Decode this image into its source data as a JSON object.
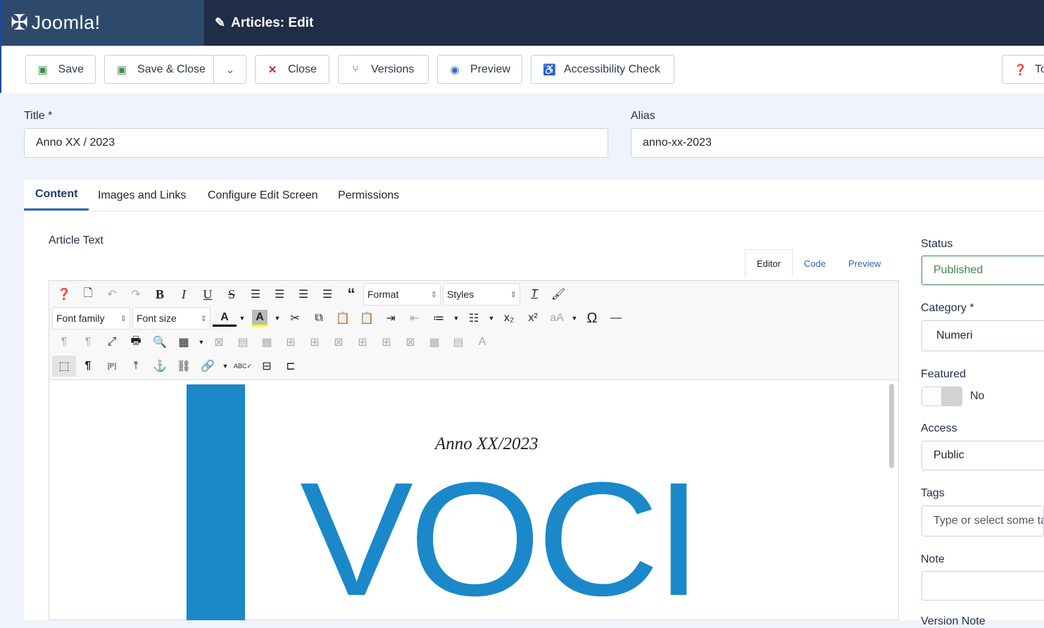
{
  "header": {
    "logo": "Joomla!",
    "title": "Articles: Edit"
  },
  "toolbar": {
    "save": "Save",
    "save_close": "Save & Close",
    "close": "Close",
    "versions": "Versions",
    "preview": "Preview",
    "accessibility": "Accessibility Check",
    "tour": "To"
  },
  "form": {
    "title_label": "Title *",
    "title_value": "Anno XX / 2023",
    "alias_label": "Alias",
    "alias_value": "anno-xx-2023"
  },
  "tabs": [
    "Content",
    "Images and Links",
    "Configure Edit Screen",
    "Permissions"
  ],
  "editor": {
    "label": "Article Text",
    "tabs": [
      "Editor",
      "Code",
      "Preview"
    ],
    "format": "Format",
    "styles": "Styles",
    "font_family": "Font family",
    "font_size": "Font size",
    "doc_subtitle": "Anno XX/2023",
    "doc_logo": "VOCI"
  },
  "sidebar": {
    "status_label": "Status",
    "status_value": "Published",
    "category_label": "Category *",
    "category_value": "Numeri",
    "featured_label": "Featured",
    "featured_value": "No",
    "access_label": "Access",
    "access_value": "Public",
    "tags_label": "Tags",
    "tags_placeholder": "Type or select some tags",
    "note_label": "Note",
    "version_note_label": "Version Note"
  },
  "colors": {
    "header": "#1f2d46",
    "logo_bg": "#2d4a6d",
    "brand_blue": "#1a88c9",
    "save_green": "#3a8a4a",
    "close_red": "#c52827"
  }
}
